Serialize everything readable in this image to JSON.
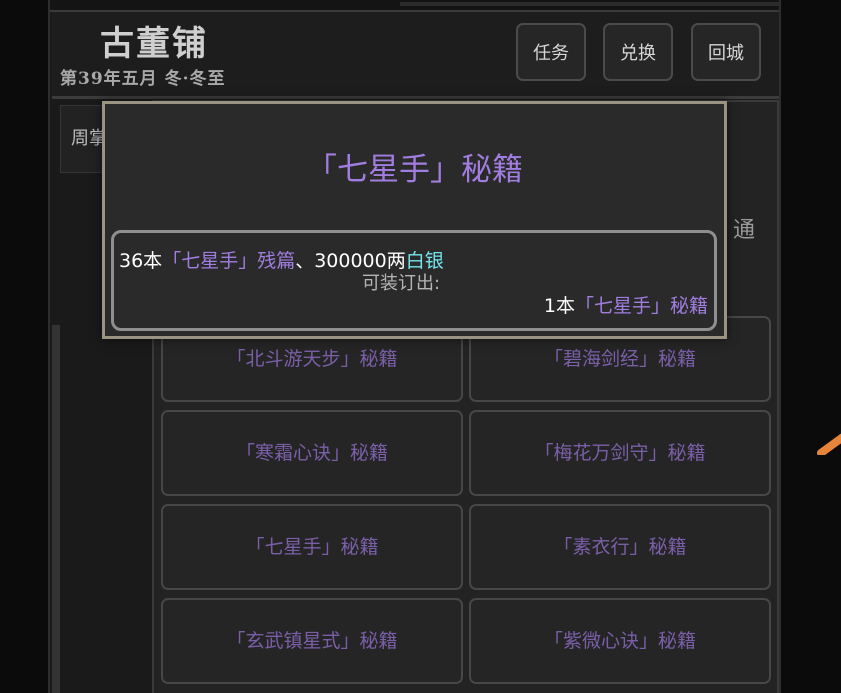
{
  "header": {
    "title": "古董铺",
    "date": "第39年五月 冬·冬至",
    "buttons": {
      "task": "任务",
      "exchange": "兑换",
      "return": "回城"
    }
  },
  "side_tab": "周掌",
  "category": {
    "label": "通"
  },
  "items": [
    "「北斗游天步」秘籍",
    "「碧海剑经」秘籍",
    "「寒霜心诀」秘籍",
    "「梅花万剑守」秘籍",
    "「七星手」秘籍",
    "「素衣行」秘籍",
    "「玄武镇星式」秘籍",
    "「紫微心诀」秘籍"
  ],
  "popup": {
    "title": "「七星手」秘籍",
    "cost": {
      "count": "36本",
      "fragment": "「七星手」残篇",
      "sep": "、300000两",
      "silver": "白银"
    },
    "bind_label": "可装订出:",
    "result": {
      "count": "1本",
      "book": "「七星手」秘籍"
    }
  },
  "colors": {
    "rare_purple": "#a17de0",
    "silver_cyan": "#74e7ee",
    "popup_border": "#9a9382"
  }
}
